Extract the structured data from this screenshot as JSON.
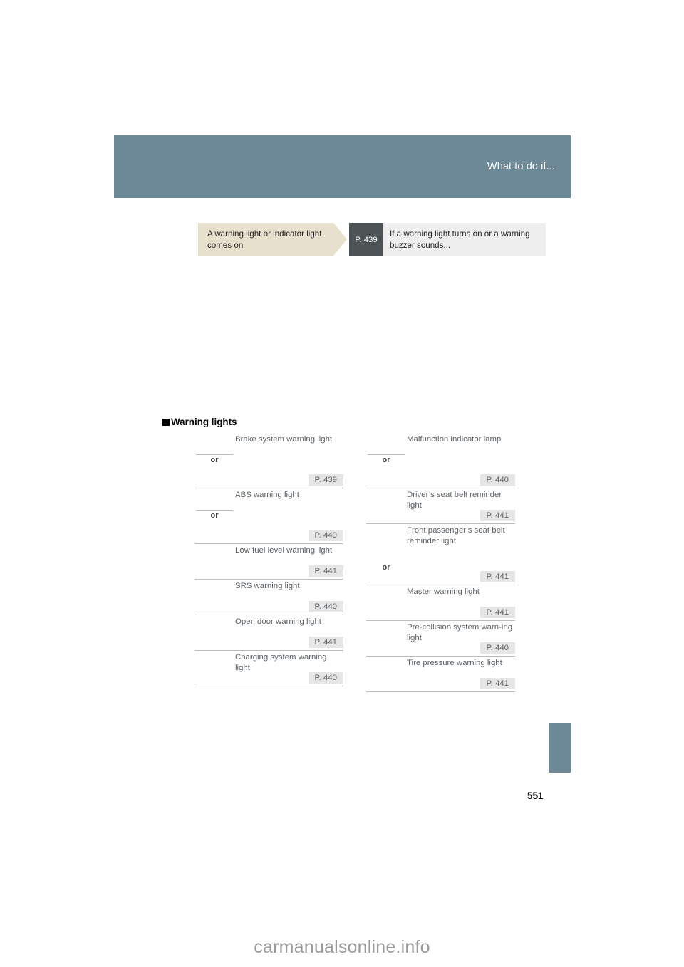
{
  "header": {
    "chapter_title": "What to do if..."
  },
  "flow": {
    "symptom": "A warning light or indicator light comes on",
    "page_ref": "P. 439",
    "action": "If a warning light turns on or a warning buzzer sounds..."
  },
  "section": {
    "heading": "Warning lights",
    "or_label": "or"
  },
  "table": {
    "left_column": [
      {
        "name": "Brake system warning light",
        "page_ref": "P. 439",
        "has_or": true,
        "height": "tall"
      },
      {
        "name": "ABS warning light",
        "page_ref": "P. 440",
        "has_or": true,
        "height": "tall"
      },
      {
        "name": "Low fuel level warning light",
        "page_ref": "P. 441",
        "has_or": false,
        "height": "short"
      },
      {
        "name": "SRS warning light",
        "page_ref": "P. 440",
        "has_or": false,
        "height": "short"
      },
      {
        "name": "Open door warning light",
        "page_ref": "P. 441",
        "has_or": false,
        "height": "short"
      },
      {
        "name": "Charging system warning light",
        "page_ref": "P. 440",
        "has_or": false,
        "height": "short"
      }
    ],
    "right_column": [
      {
        "name": "Malfunction indicator lamp",
        "page_ref": "P. 440",
        "has_or": true,
        "height": "tall"
      },
      {
        "name": "Driver’s seat belt reminder light",
        "page_ref": "P. 441",
        "has_or": false,
        "height": "short"
      },
      {
        "name": "Front passenger’s seat belt reminder light",
        "page_ref": "P. 441",
        "has_or": true,
        "height": "xtall"
      },
      {
        "name": "Master warning light",
        "page_ref": "P. 441",
        "has_or": false,
        "height": "short"
      },
      {
        "name": "Pre-collision system warn-ing light",
        "page_ref": "P. 440",
        "has_or": false,
        "height": "short"
      },
      {
        "name": "Tire pressure warning light",
        "page_ref": "P. 441",
        "has_or": false,
        "height": "short"
      }
    ]
  },
  "footer": {
    "page_number": "551",
    "watermark": "carmanualsonline.info"
  },
  "colors": {
    "chapter_band": "#6d8897",
    "symptom_box": "#e7e0cc",
    "ref_box": "#4e5356",
    "action_box": "#eeeeee",
    "page_ref_chip": "#e6e6e6",
    "rule_line": "#b7bfc3"
  }
}
